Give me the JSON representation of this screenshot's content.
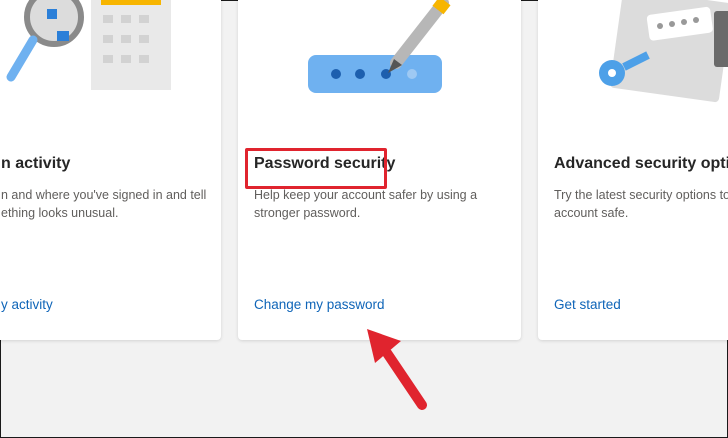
{
  "cards": [
    {
      "title_visible": "n activity",
      "desc_visible": "n and where you've signed in and tell\nething looks unusual.",
      "link_visible": "y activity",
      "illustration": "magnifier-calendar-illustration"
    },
    {
      "title": "Password security",
      "desc": "Help keep your account safer by using a\nstronger password.",
      "link": "Change my password",
      "illustration": "password-field-pen-illustration"
    },
    {
      "title_visible": "Advanced security optio",
      "desc_visible": "Try the latest security options to h\naccount safe.",
      "link": "Get started",
      "illustration": "key-lock-illustration"
    }
  ],
  "annotations": {
    "highlight_color": "#e0242e",
    "arrow_color": "#e0242e"
  },
  "colors": {
    "link": "#0f65b8",
    "title": "#262626",
    "desc": "#605e5c",
    "background": "#f2f2f2"
  }
}
